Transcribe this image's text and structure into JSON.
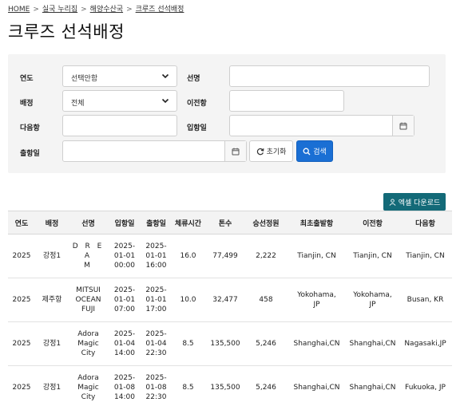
{
  "breadcrumb": {
    "home": "HOME",
    "item1": "실국 누리집",
    "item2": "해양수산국",
    "item3": "크루즈 선석배정"
  },
  "page_title": "크루즈 선석배정",
  "filters": {
    "year_label": "연도",
    "year_value": "선택안함",
    "ship_label": "선명",
    "ship_value": "",
    "berth_label": "배정",
    "berth_value": "전체",
    "prev_port_label": "이전항",
    "prev_port_value": "",
    "next_port_label": "다음항",
    "next_port_value": "",
    "arrival_label": "입항일",
    "arrival_value": "",
    "departure_label": "출항일",
    "departure_value": ""
  },
  "buttons": {
    "reset": "초기화",
    "search": "검색",
    "excel": "엑셀 다운로드"
  },
  "table": {
    "columns": [
      "연도",
      "배정",
      "선명",
      "입항일",
      "출항일",
      "체류시간",
      "톤수",
      "승선정원",
      "최초출발항",
      "이전항",
      "다음항"
    ],
    "rows": [
      [
        "2025",
        "강정1",
        "D R E A\nM",
        "2025-\n01-01\n00:00",
        "2025-\n01-01\n16:00",
        "16.0",
        "77,499",
        "2,222",
        "Tianjin, CN",
        "Tianjin, CN",
        "Tianjin, CN"
      ],
      [
        "2025",
        "제주항",
        "MITSUI\nOCEAN\nFUJI",
        "2025-\n01-01\n07:00",
        "2025-\n01-01\n17:00",
        "10.0",
        "32,477",
        "458",
        "Yokohama,\nJP",
        "Yokohama,\nJP",
        "Busan, KR"
      ],
      [
        "2025",
        "강정1",
        "Adora\nMagic\nCity",
        "2025-\n01-04\n14:00",
        "2025-\n01-04\n22:30",
        "8.5",
        "135,500",
        "5,246",
        "Shanghai,CN",
        "Shanghai,CN",
        "Nagasaki,JP"
      ],
      [
        "2025",
        "강정1",
        "Adora\nMagic\nCity",
        "2025-\n01-08\n14:00",
        "2025-\n01-08\n22:30",
        "8.5",
        "135,500",
        "5,246",
        "Shanghai,CN",
        "Shanghai,CN",
        "Fukuoka, JP"
      ]
    ]
  },
  "colors": {
    "primary": "#1a6fd4",
    "excel": "#136a78",
    "panel_bg": "#f4f4f4"
  },
  "icons": {
    "chevron": "chevron-down-icon",
    "calendar": "calendar-icon",
    "refresh": "refresh-icon",
    "search": "search-icon",
    "excel": "user-download-icon"
  }
}
